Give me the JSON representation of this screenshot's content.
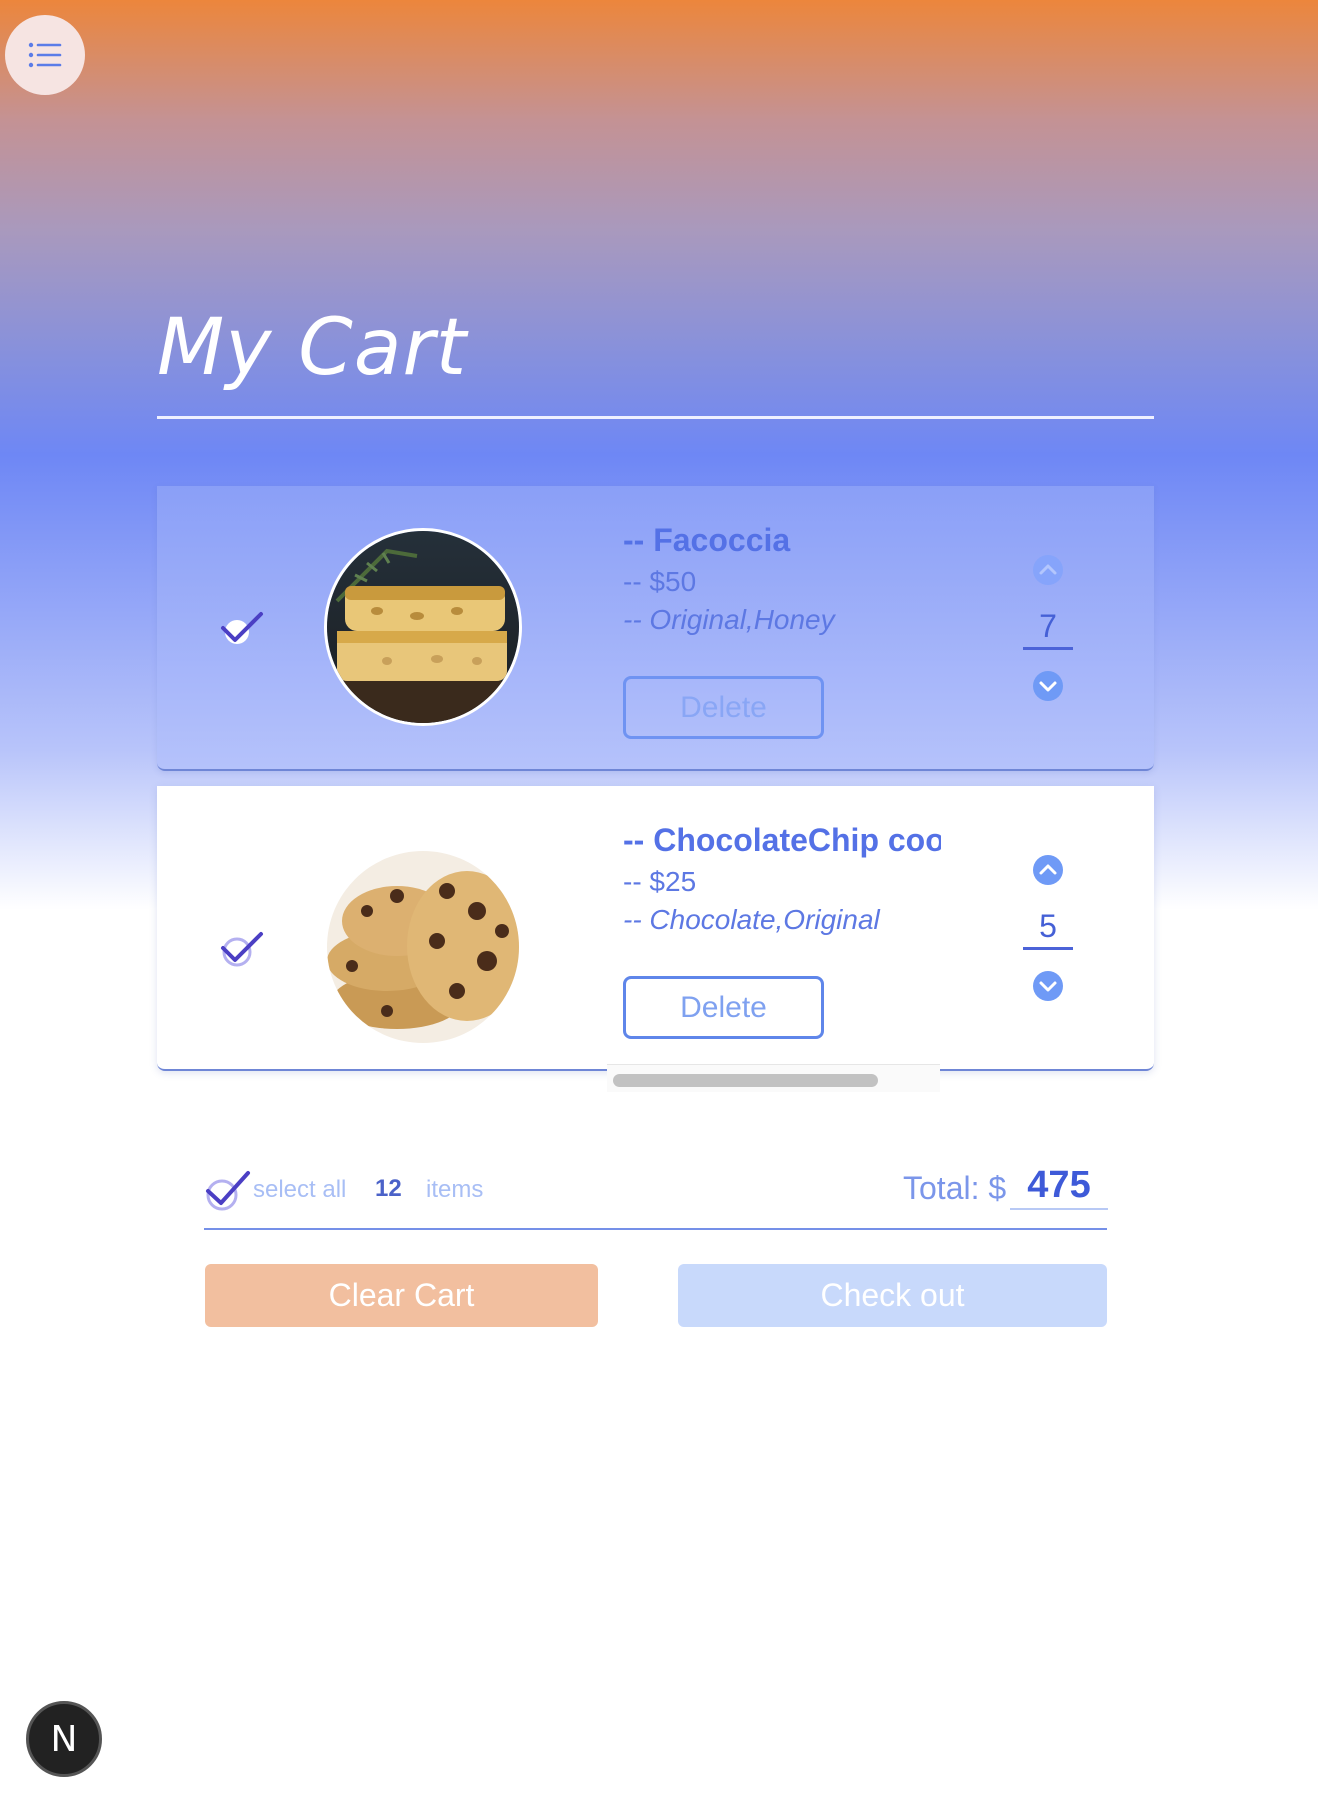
{
  "header": {
    "menu_icon": "list-icon",
    "title": "My Cart"
  },
  "cart": {
    "items": [
      {
        "name": "-- Facoccia",
        "price": "-- $50",
        "flavors": "-- Original,Honey",
        "delete_label": "Delete",
        "quantity": "7",
        "selected": true,
        "image_icon": "focaccia-photo"
      },
      {
        "name": "-- ChocolateChip cookies",
        "price": "-- $25",
        "flavors": "-- Chocolate,Original",
        "delete_label": "Delete",
        "quantity": "5",
        "selected": true,
        "image_icon": "cookies-photo"
      }
    ]
  },
  "summary": {
    "select_all_label": "select all",
    "item_count": "12",
    "items_label": "items",
    "total_label": "Total: $",
    "total_value": "475"
  },
  "actions": {
    "clear_label": "Clear Cart",
    "checkout_label": "Check out"
  },
  "dev_badge": {
    "letter": "N"
  },
  "colors": {
    "accent": "#5471e6",
    "clear_button": "#f2bf9f",
    "checkout_button": "#c8d9fb",
    "gradient_top": "#ec863c",
    "gradient_mid": "#6e87f5"
  }
}
